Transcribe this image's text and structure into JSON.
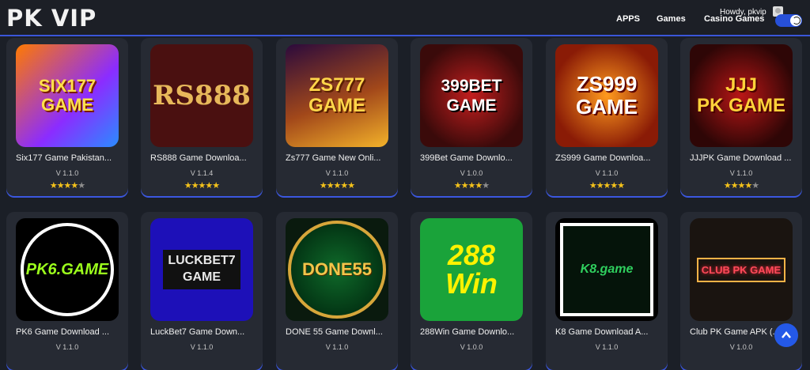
{
  "brand": {
    "logo": "PK VIP"
  },
  "nav": {
    "apps": "APPS",
    "games": "Games",
    "casino": "Casino Games"
  },
  "user": {
    "howdy": "Howdy, pkvip"
  },
  "row1": [
    {
      "title": "Six177 Game Pakistan...",
      "version": "V 1.1.0",
      "thumb": "SIX177\nGAME",
      "rating": 4
    },
    {
      "title": "RS888 Game Downloa...",
      "version": "V 1.1.4",
      "thumb": "RS888",
      "rating": 4.5
    },
    {
      "title": "Zs777 Game New Onli...",
      "version": "V 1.1.0",
      "thumb": "ZS777\nGAME",
      "rating": 4.5
    },
    {
      "title": "399Bet Game Downlo...",
      "version": "V 1.0.0",
      "thumb": "399BET\nGAME",
      "rating": 4
    },
    {
      "title": "ZS999 Game Downloa...",
      "version": "V 1.1.0",
      "thumb": "ZS999\nGAME",
      "rating": 4.5
    },
    {
      "title": "JJJPK Game Download ...",
      "version": "V 1.1.0",
      "thumb": "JJJ\nPK GAME",
      "rating": 4
    }
  ],
  "row2": [
    {
      "title": "PK6 Game Download ...",
      "version": "V 1.1.0",
      "thumb": "PK6.GAME"
    },
    {
      "title": "LuckBet7 Game Down...",
      "version": "V 1.1.0",
      "thumb": "LUCKBET7\nGAME"
    },
    {
      "title": "DONE 55 Game Downl...",
      "version": "V 1.1.0",
      "thumb": "DONE55"
    },
    {
      "title": "288Win Game Downlo...",
      "version": "V 1.0.0",
      "thumb": "288\nWin"
    },
    {
      "title": "K8 Game Download A...",
      "version": "V 1.1.0",
      "thumb": "K8.game"
    },
    {
      "title": "Club PK Game APK (...",
      "version": "V 1.0.0",
      "thumb": "CLUB PK GAME"
    }
  ],
  "icons": {
    "scroll_top": "chevron-up-icon",
    "theme_toggle": "moon-icon",
    "avatar": "avatar-icon"
  }
}
